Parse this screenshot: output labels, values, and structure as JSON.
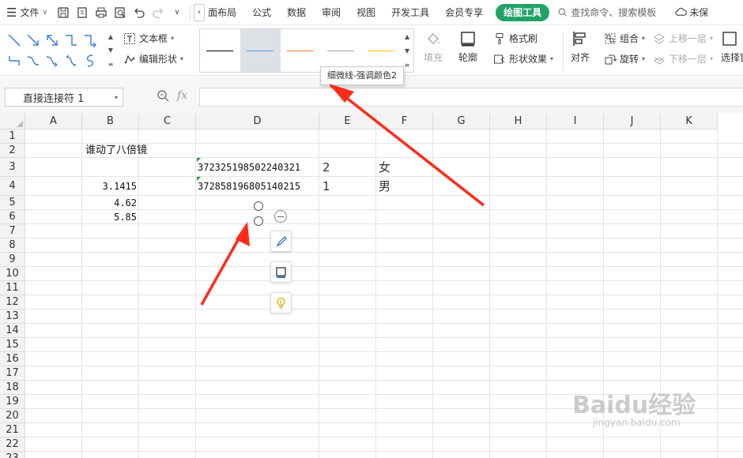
{
  "menubar": {
    "file_label": "文件",
    "tabs": [
      "页面布局",
      "公式",
      "数据",
      "审阅",
      "视图",
      "开发工具",
      "会员专享"
    ],
    "tab_partial": "面布局",
    "active_tab": "绘图工具",
    "search_placeholder": "查找命令、搜索模板",
    "unsync_label": "未保"
  },
  "ribbon": {
    "textbox_label": "文本框",
    "edit_shape_label": "编辑形状",
    "line_styles": [
      {
        "color": "#000000",
        "selected": false
      },
      {
        "color": "#5b9bd5",
        "selected": true
      },
      {
        "color": "#ed7d31",
        "selected": false
      },
      {
        "color": "#a5a5a5",
        "selected": false
      },
      {
        "color": "#ffc000",
        "selected": false
      }
    ],
    "fill_label": "填充",
    "outline_label": "轮廓",
    "format_painter_label": "格式刷",
    "shape_effect_label": "形状效果",
    "align_label": "对齐",
    "group_label": "组合",
    "rotate_label": "旋转",
    "bring_forward_label": "上移一层",
    "send_backward_label": "下移一层",
    "select_pane_label": "选择窗"
  },
  "tooltip": "细微线-强调颜色2",
  "formula_bar": {
    "name_box": "直接连接符 1",
    "fx": "fx",
    "content": ""
  },
  "sheet": {
    "columns": [
      "A",
      "B",
      "C",
      "D",
      "E",
      "F",
      "G",
      "H",
      "I",
      "J",
      "K"
    ],
    "rows": [
      "1",
      "2",
      "3",
      "4",
      "5",
      "6",
      "7",
      "8",
      "9",
      "10",
      "11",
      "12",
      "13",
      "14",
      "15",
      "16",
      "17",
      "18",
      "19",
      "20",
      "21",
      "22",
      "23"
    ],
    "cells": {
      "B2": "谁动了八倍镜",
      "D3": "372325198502240321",
      "E3": "2",
      "F3": "女",
      "B4": "3.1415",
      "D4": "372858196805140215",
      "E4": "1",
      "F4": "男",
      "B5": "4.62",
      "B6": "5.85"
    }
  },
  "watermark": {
    "brand": "Baidu经验",
    "url": "jingyan.baidu.com"
  }
}
